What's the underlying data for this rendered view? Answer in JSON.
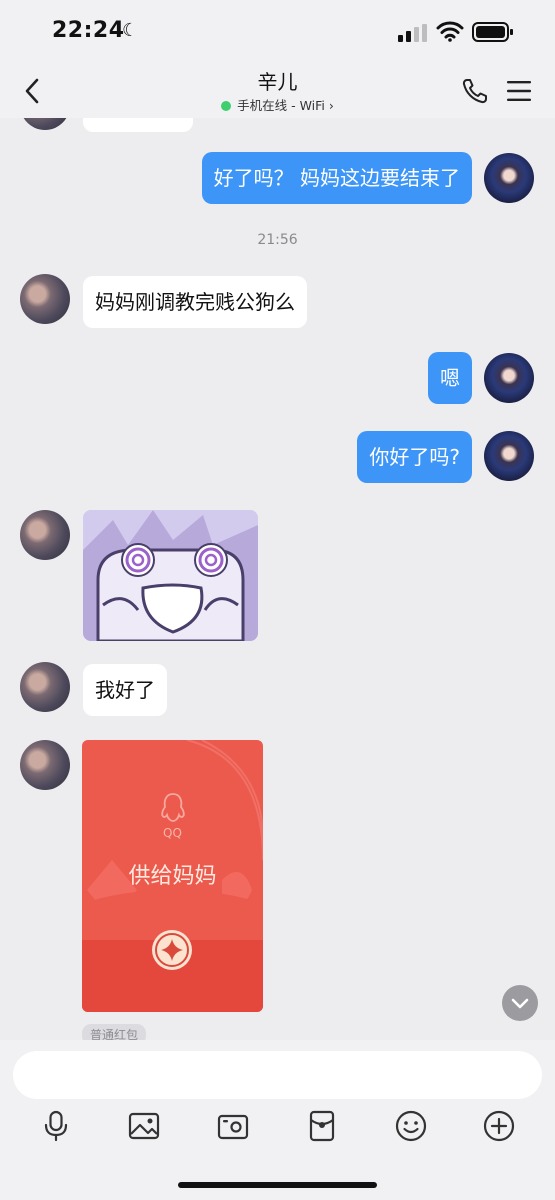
{
  "status_bar": {
    "time": "22:24",
    "moon_icon": "moon-icon",
    "signal_icon": "signal-icon",
    "wifi_icon": "wifi-icon",
    "battery_icon": "battery-icon"
  },
  "header": {
    "title": "辛儿",
    "status": "手机在线 - WiFi",
    "status_dot_color": "#3ecf6e",
    "back_icon": "chevron-left-icon",
    "call_icon": "phone-icon",
    "menu_icon": "menu-icon"
  },
  "chat": {
    "timestamp": "21:56",
    "messages": [
      {
        "side": "out",
        "type": "text",
        "text": "好了吗？ 妈妈这边要结束了"
      },
      {
        "side": "in",
        "type": "text",
        "text": "妈妈刚调教完贱公狗么"
      },
      {
        "side": "out",
        "type": "text",
        "text": "嗯"
      },
      {
        "side": "out",
        "type": "text",
        "text": "你好了吗?"
      },
      {
        "side": "in",
        "type": "sticker",
        "text": ""
      },
      {
        "side": "in",
        "type": "text",
        "text": "我好了"
      },
      {
        "side": "in",
        "type": "red_packet",
        "text": "供给妈妈"
      }
    ],
    "red_packet": {
      "brand": "QQ",
      "greeting": "供给妈妈",
      "tag": "普通红包"
    },
    "colors": {
      "outgoing_bubble": "#3d96f7",
      "incoming_bubble": "#ffffff",
      "red_packet": "#ec5a4d"
    }
  },
  "input": {
    "value": "",
    "placeholder": ""
  },
  "toolbar": {
    "icons": [
      "mic-icon",
      "image-icon",
      "camera-icon",
      "red-packet-icon",
      "emoji-icon",
      "plus-icon"
    ]
  }
}
